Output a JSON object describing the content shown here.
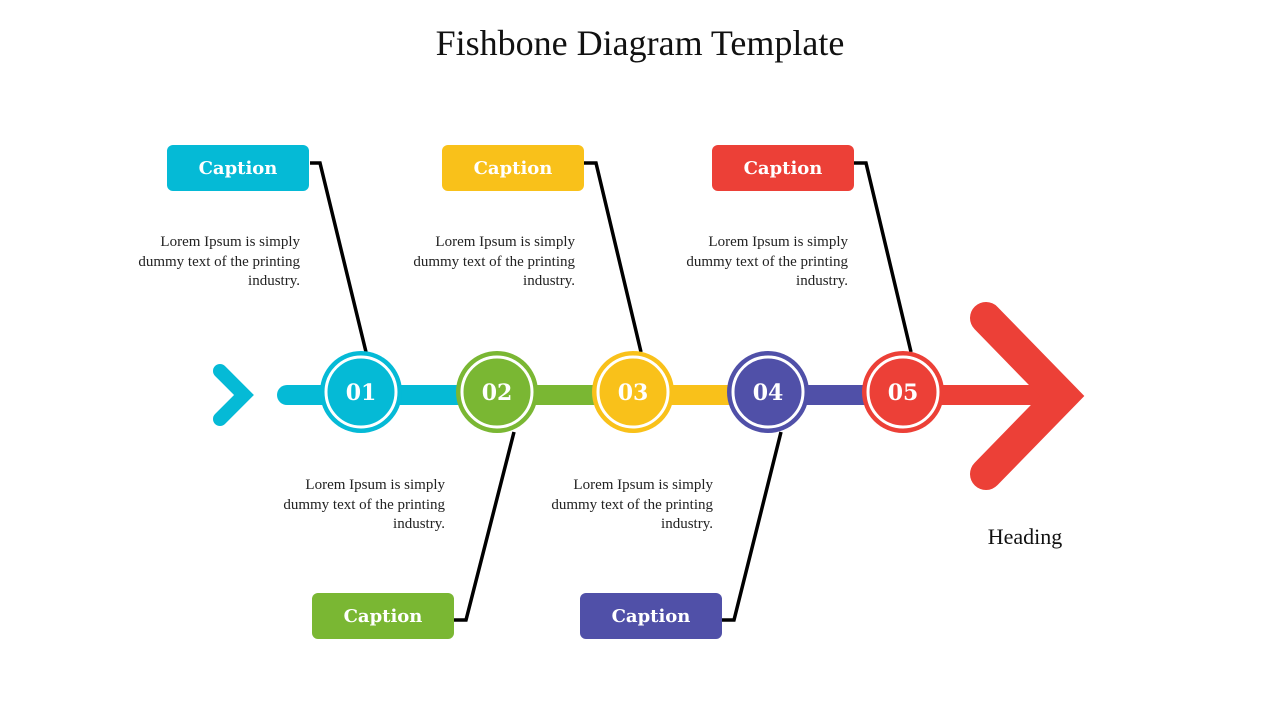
{
  "title": "Fishbone Diagram Template",
  "heading": "Heading",
  "colors": {
    "cyan": "#05BAD6",
    "green": "#7AB733",
    "yellow": "#F9C11A",
    "indigo": "#5050A8",
    "red": "#EC4037",
    "connector": "#000000"
  },
  "nodes": [
    {
      "label": "01",
      "color": "#05BAD6",
      "caption": "Caption",
      "caption_position": "top",
      "text": "Lorem Ipsum is simply dummy text of the printing industry."
    },
    {
      "label": "02",
      "color": "#7AB733",
      "caption": "Caption",
      "caption_position": "bottom",
      "text": "Lorem Ipsum is simply dummy text of the printing industry."
    },
    {
      "label": "03",
      "color": "#F9C11A",
      "caption": "Caption",
      "caption_position": "top",
      "text": "Lorem Ipsum is simply dummy text of the printing industry."
    },
    {
      "label": "04",
      "color": "#5050A8",
      "caption": "Caption",
      "caption_position": "bottom",
      "text": "Lorem Ipsum is simply dummy text of the printing industry."
    },
    {
      "label": "05",
      "color": "#EC4037",
      "caption": "Caption",
      "caption_position": "top",
      "text": "Lorem Ipsum is simply dummy text of the printing industry."
    }
  ]
}
